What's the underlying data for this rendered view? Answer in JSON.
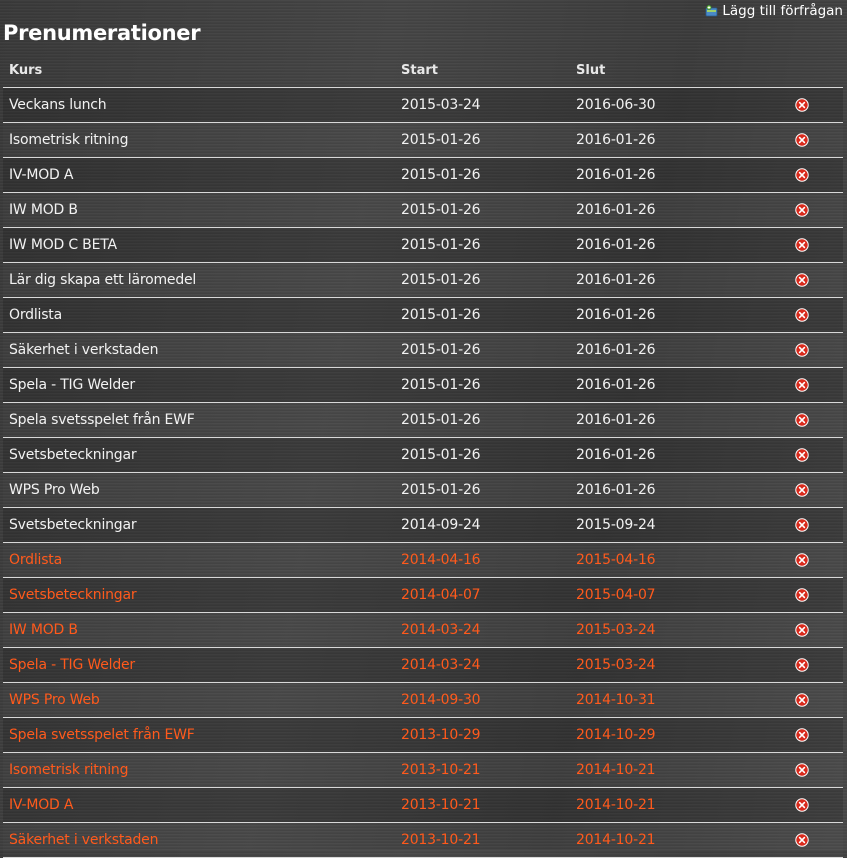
{
  "header": {
    "add_request_label": "Lägg till förfrågan",
    "add_request_icon": "add-request-icon",
    "title": "Prenumerationer"
  },
  "table": {
    "columns": [
      "Kurs",
      "Start",
      "Slut"
    ],
    "delete_icon": "delete-circle-icon",
    "rows": [
      {
        "kurs": "Veckans lunch",
        "start": "2015-03-24",
        "slut": "2016-06-30",
        "status": "active"
      },
      {
        "kurs": "Isometrisk ritning",
        "start": "2015-01-26",
        "slut": "2016-01-26",
        "status": "active"
      },
      {
        "kurs": "IV-MOD A",
        "start": "2015-01-26",
        "slut": "2016-01-26",
        "status": "active"
      },
      {
        "kurs": "IW MOD B",
        "start": "2015-01-26",
        "slut": "2016-01-26",
        "status": "active"
      },
      {
        "kurs": "IW MOD C BETA",
        "start": "2015-01-26",
        "slut": "2016-01-26",
        "status": "active"
      },
      {
        "kurs": "Lär dig skapa ett läromedel",
        "start": "2015-01-26",
        "slut": "2016-01-26",
        "status": "active"
      },
      {
        "kurs": "Ordlista",
        "start": "2015-01-26",
        "slut": "2016-01-26",
        "status": "active"
      },
      {
        "kurs": "Säkerhet i verkstaden",
        "start": "2015-01-26",
        "slut": "2016-01-26",
        "status": "active"
      },
      {
        "kurs": "Spela - TIG Welder",
        "start": "2015-01-26",
        "slut": "2016-01-26",
        "status": "active"
      },
      {
        "kurs": "Spela svetsspelet från EWF",
        "start": "2015-01-26",
        "slut": "2016-01-26",
        "status": "active"
      },
      {
        "kurs": "Svetsbeteckningar",
        "start": "2015-01-26",
        "slut": "2016-01-26",
        "status": "active"
      },
      {
        "kurs": "WPS Pro Web",
        "start": "2015-01-26",
        "slut": "2016-01-26",
        "status": "active"
      },
      {
        "kurs": "Svetsbeteckningar",
        "start": "2014-09-24",
        "slut": "2015-09-24",
        "status": "active"
      },
      {
        "kurs": "Ordlista",
        "start": "2014-04-16",
        "slut": "2015-04-16",
        "status": "expired"
      },
      {
        "kurs": "Svetsbeteckningar",
        "start": "2014-04-07",
        "slut": "2015-04-07",
        "status": "expired"
      },
      {
        "kurs": "IW MOD B",
        "start": "2014-03-24",
        "slut": "2015-03-24",
        "status": "expired"
      },
      {
        "kurs": "Spela - TIG Welder",
        "start": "2014-03-24",
        "slut": "2015-03-24",
        "status": "expired"
      },
      {
        "kurs": "WPS Pro Web",
        "start": "2014-09-30",
        "slut": "2014-10-31",
        "status": "expired"
      },
      {
        "kurs": "Spela svetsspelet från EWF",
        "start": "2013-10-29",
        "slut": "2014-10-29",
        "status": "expired"
      },
      {
        "kurs": "Isometrisk ritning",
        "start": "2013-10-21",
        "slut": "2014-10-21",
        "status": "expired"
      },
      {
        "kurs": "IV-MOD A",
        "start": "2013-10-21",
        "slut": "2014-10-21",
        "status": "expired"
      },
      {
        "kurs": "Säkerhet i verkstaden",
        "start": "2013-10-21",
        "slut": "2014-10-21",
        "status": "expired"
      }
    ]
  },
  "colors": {
    "active_text": "#f2f2f2",
    "expired_text": "#ff5a1c",
    "delete_icon_fill": "#d92a1c",
    "row_border": "#d8d8d8"
  }
}
